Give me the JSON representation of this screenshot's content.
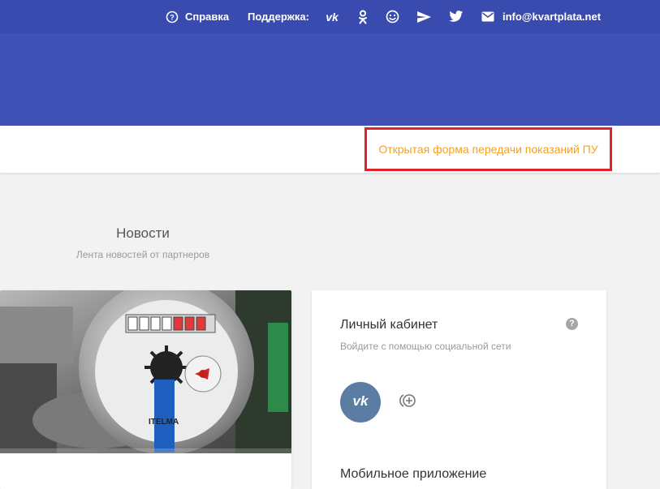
{
  "topbar": {
    "help_label": "Справка",
    "support_label": "Поддержка:",
    "email": "info@kvartplata.net",
    "social_icons": [
      "vk-icon",
      "odnoklassniki-icon",
      "smiley-icon",
      "telegram-icon",
      "twitter-icon",
      "email-icon"
    ]
  },
  "navbar": {
    "open_form_link": "Открытая форма передачи показаний ПУ"
  },
  "news": {
    "title": "Новости",
    "subtitle": "Лента новостей от партнеров",
    "image_alt": "water-meter-photo",
    "meter_brand": "ITELMA"
  },
  "login": {
    "title": "Личный кабинет",
    "subtitle": "Войдите с помощью социальной сети",
    "help_icon": "?",
    "vk_button_icon": "vk-icon",
    "add_icon": "add-social-icon"
  },
  "mobile": {
    "title": "Мобильное приложение"
  },
  "colors": {
    "header_blue": "#3f51b5",
    "topbar_blue": "#3a4bb0",
    "link_orange": "#f5a11f",
    "highlight_red": "#e0222a",
    "vk_blue": "#5b7ca3"
  }
}
